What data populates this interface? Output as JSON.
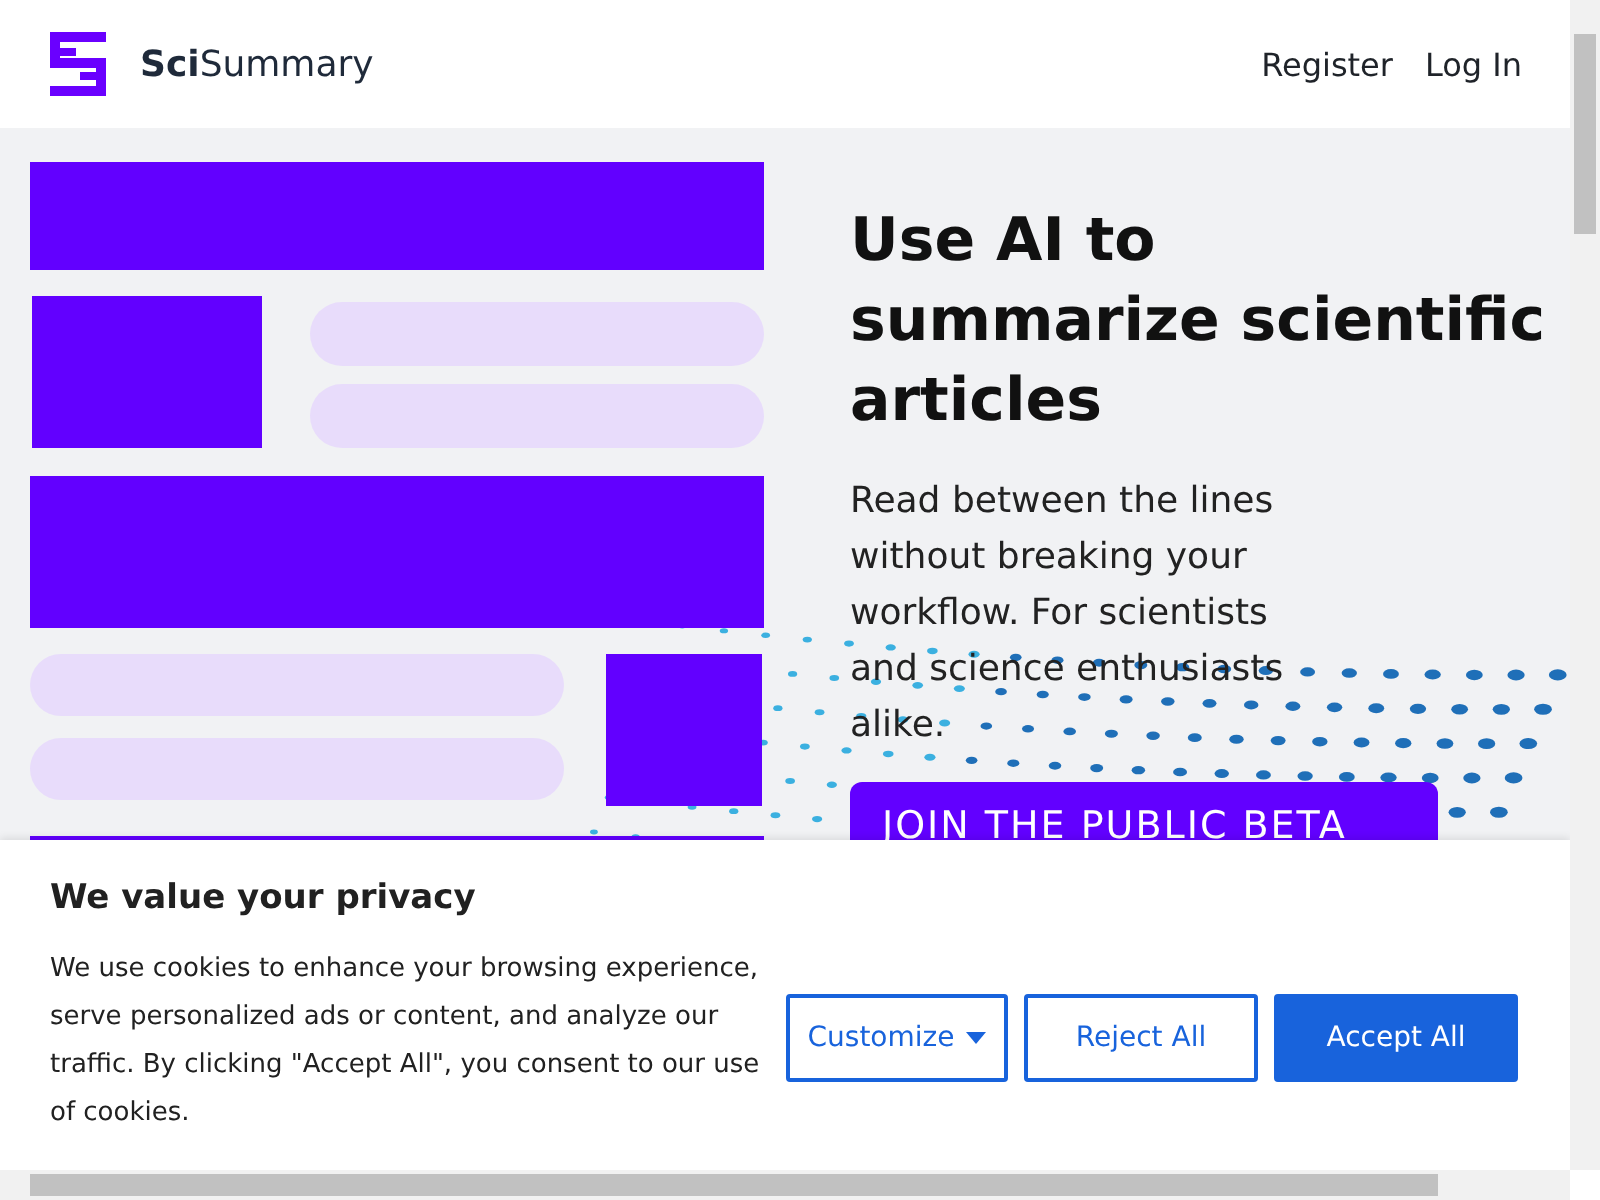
{
  "header": {
    "brand": "**Sci**Summary",
    "nav": [
      "Register",
      "Log In"
    ]
  },
  "hero": {
    "title": "Use AI to\nsummarize scientific\narticles",
    "text": "Read between the lines without breaking your workflow. For scientists and science enthusiasts alike.",
    "button": "JOIN THE PUBLIC BETA"
  },
  "cookie_banner": {
    "title": "We value your privacy",
    "text": "We use cookies to enhance your browsing experience, serve personalized ads or content, and analyze our traffic. By clicking \"Accept All\", you consent to our use of cookies.",
    "buttons": [
      {
        "label": "Customize",
        "kind": "dropdown"
      },
      {
        "label": "Reject All",
        "kind": "outline"
      },
      {
        "label": "Accept All",
        "kind": "primary"
      }
    ]
  }
}
